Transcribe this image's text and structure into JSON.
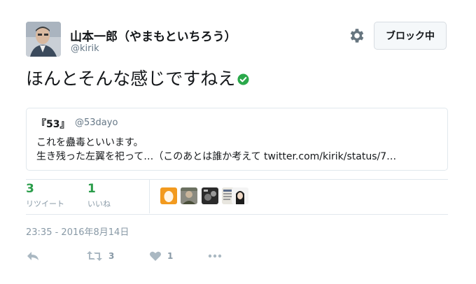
{
  "tweet": {
    "display_name": "山本一郎（やまもといちろう）",
    "handle": "@kirik",
    "text": "ほんとそんな感じですねえ",
    "timestamp": "23:35 - 2016年8月14日"
  },
  "header": {
    "block_label": "ブロック中"
  },
  "quote": {
    "name": "『53』",
    "handle": "@53dayo",
    "line1": "これを蠱毒といいます。",
    "line2": "生き残った左翼を祀って…（このあとは誰か考えて twitter.com/kirik/status/7…"
  },
  "stats": {
    "retweets": "3",
    "retweets_label": "リツイート",
    "likes": "1",
    "likes_label": "いいね"
  },
  "actions": {
    "retweet_count": "3",
    "like_count": "1"
  },
  "colors": {
    "stat_green": "#2a9d4a",
    "muted": "#8899a6",
    "border": "#e1e8ed"
  },
  "icons": [
    "gear-icon",
    "verified-badge-icon",
    "reply-icon",
    "retweet-icon",
    "heart-icon",
    "more-icon"
  ]
}
